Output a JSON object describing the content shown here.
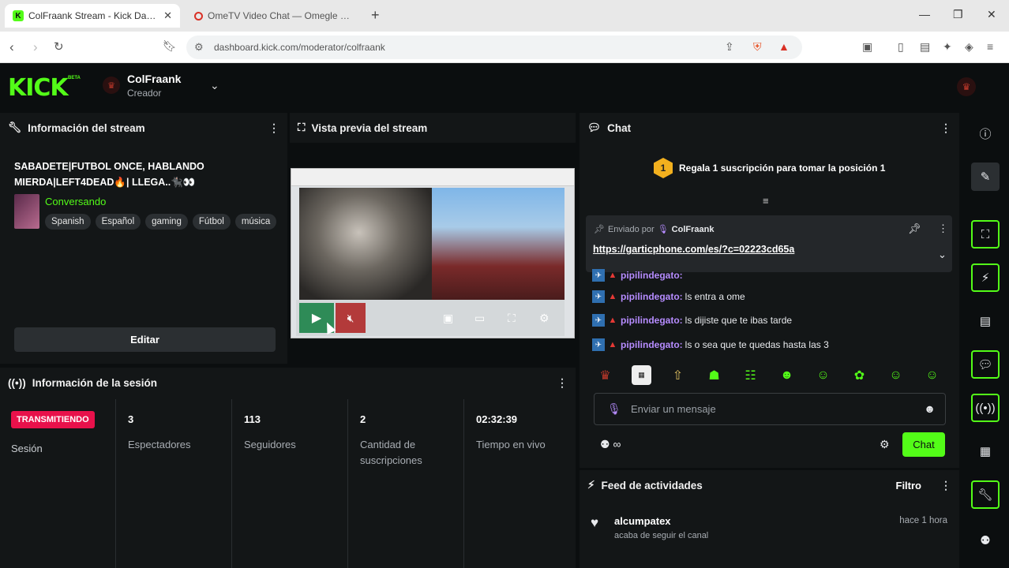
{
  "browser": {
    "tabs": [
      {
        "title": "ColFraank Stream - Kick Dashbo",
        "active": true
      },
      {
        "title": "OmeTV Video Chat — Omegle Rando",
        "active": false
      }
    ],
    "url": "dashboard.kick.com/moderator/colfraank"
  },
  "header": {
    "logo": "KICK",
    "logo_badge": "BETA",
    "channel_name": "ColFraank",
    "channel_role": "Creador"
  },
  "stream_info": {
    "title_label": "Información del stream",
    "stream_title": "SABADETE|FUTBOL ONCE, HABLANDO MIERDA|LEFT4DEAD🔥| LLEGA..🐈‍⬛👀",
    "category": "Conversando",
    "tags": [
      "Spanish",
      "Español",
      "gaming",
      "Fútbol",
      "música"
    ],
    "edit_label": "Editar"
  },
  "preview": {
    "title_label": "Vista previa del stream"
  },
  "session": {
    "title_label": "Información de la sesión",
    "live_badge": "TRANSMITIENDO",
    "session_label": "Sesión",
    "stats": [
      {
        "value": "3",
        "label": "Espectadores"
      },
      {
        "value": "113",
        "label": "Seguidores"
      },
      {
        "value": "2",
        "label": "Cantidad de suscripciones"
      },
      {
        "value": "02:32:39",
        "label": "Tiempo en vivo"
      }
    ]
  },
  "chat": {
    "title_label": "Chat",
    "goal_number": "1",
    "goal_text": "Regala 1 suscripción para tomar la posición 1",
    "pinned_by_label": "Enviado por",
    "pinned_by_user": "ColFraank",
    "pinned_link": "https://garticphone.com/es/?c=02223cd65a",
    "messages": [
      {
        "user": "pipilindegato:",
        "text": ""
      },
      {
        "user": "pipilindegato:",
        "text": "ls entra a ome"
      },
      {
        "user": "pipilindegato:",
        "text": "ls dijiste que te ibas tarde"
      },
      {
        "user": "pipilindegato:",
        "text": "ls o sea que te quedas hasta las 3"
      }
    ],
    "input_placeholder": "Enviar un mensaje",
    "points_label": "∞",
    "send_label": "Chat"
  },
  "feed": {
    "title_label": "Feed de actividades",
    "filter_label": "Filtro",
    "items": [
      {
        "user": "alcumpatex",
        "time": "hace 1 hora",
        "desc": "acaba de seguir el canal"
      }
    ]
  },
  "colors": {
    "accent": "#53fc18",
    "live": "#e8114b",
    "username": "#b68cff",
    "panel_bg": "#131617",
    "page_bg": "#0b0e0f"
  }
}
